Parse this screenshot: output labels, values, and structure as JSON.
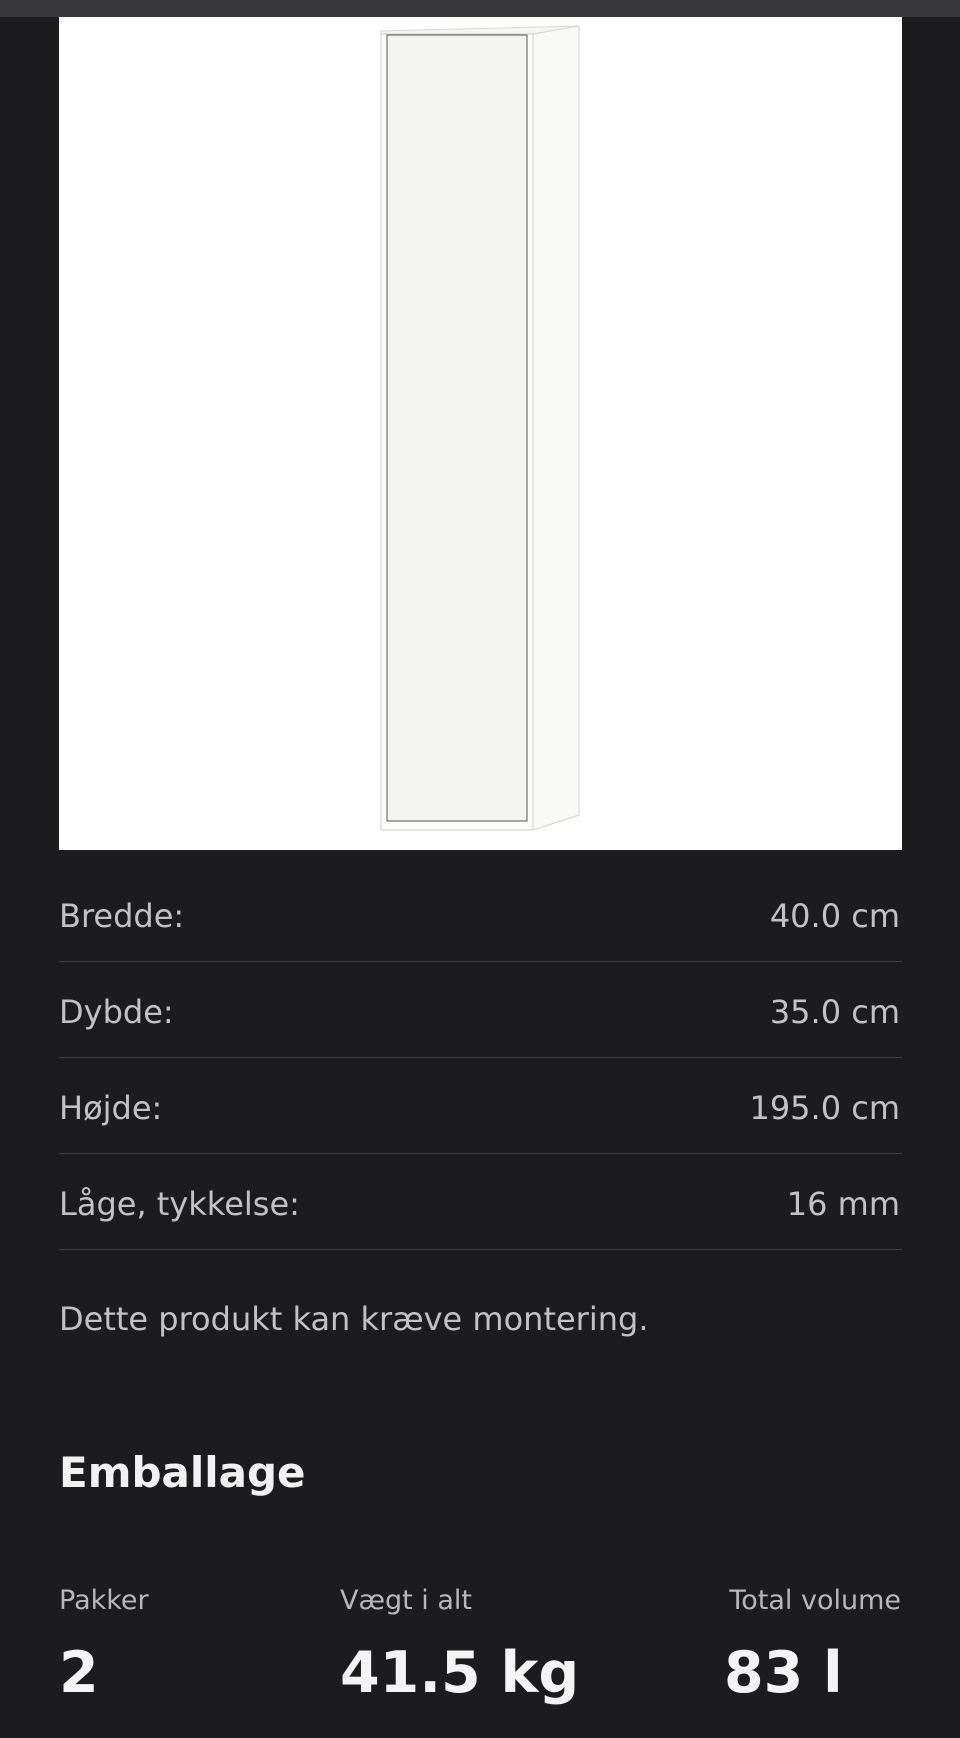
{
  "product": {
    "image_alt": "Høj hvid badeværelsesskab med låge"
  },
  "dimensions": [
    {
      "label": "Bredde:",
      "value": "40.0 cm"
    },
    {
      "label": "Dybde:",
      "value": "35.0 cm"
    },
    {
      "label": "Højde:",
      "value": "195.0 cm"
    },
    {
      "label": "Låge, tykkelse:",
      "value": "16 mm"
    }
  ],
  "assembly_note": "Dette produkt kan kræve montering.",
  "packaging": {
    "title": "Emballage",
    "packages": {
      "label": "Pakker",
      "value": "2"
    },
    "weight": {
      "label": "Vægt i alt",
      "value": "41.5 kg"
    },
    "volume": {
      "label": "Total volume",
      "value": "83 l"
    }
  },
  "colors": {
    "background": "#1c1c1e",
    "divider": "#3e3e41",
    "text_primary": "#f2f2f2",
    "text_secondary": "#c2c2c2"
  }
}
